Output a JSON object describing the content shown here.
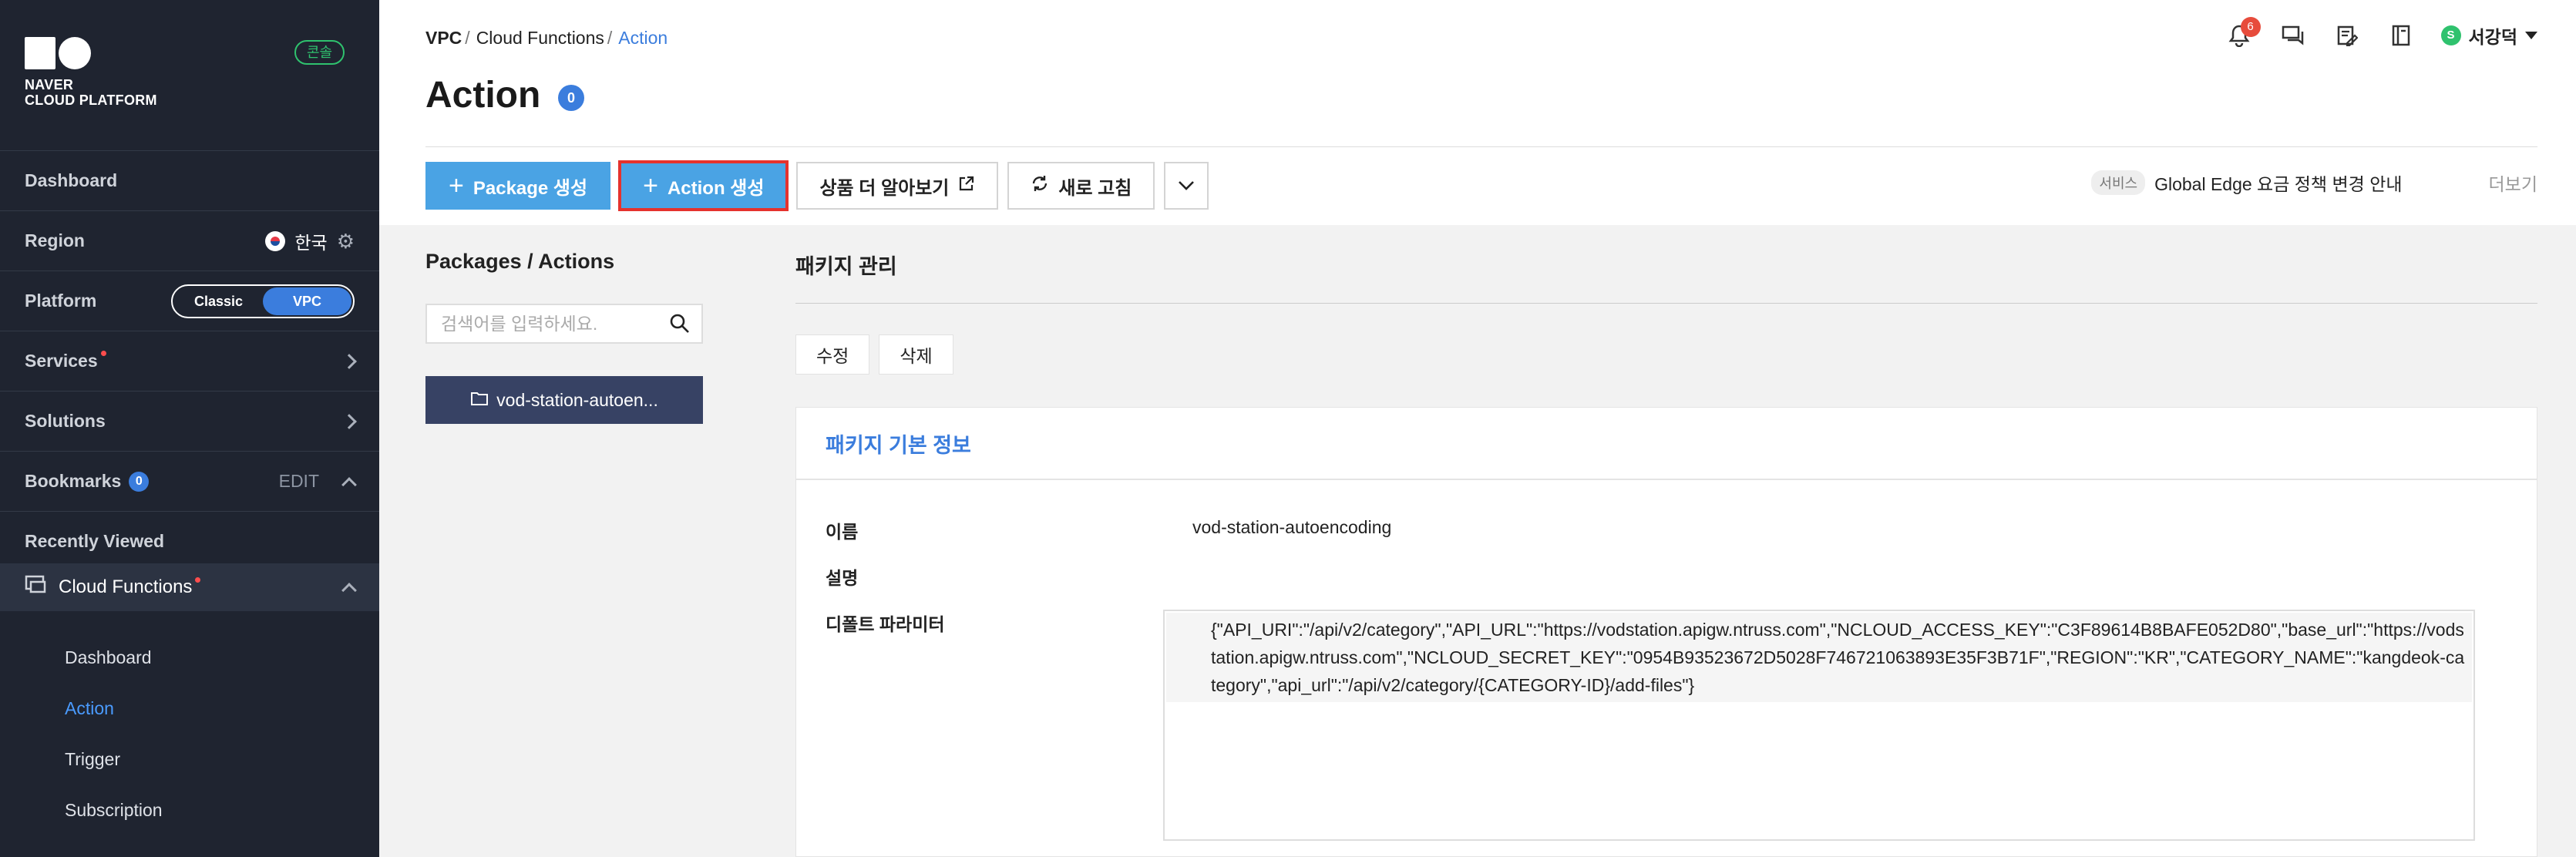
{
  "brand": {
    "line1": "NAVER",
    "line2": "CLOUD PLATFORM",
    "console_badge": "콘솔"
  },
  "sidebar": {
    "dashboard": "Dashboard",
    "region": {
      "label": "Region",
      "value": "한국"
    },
    "platform": {
      "label": "Platform",
      "options": [
        "Classic",
        "VPC"
      ],
      "selected": "VPC"
    },
    "services": "Services",
    "solutions": "Solutions",
    "bookmarks": {
      "label": "Bookmarks",
      "count": "0",
      "edit": "EDIT"
    },
    "recently_viewed": "Recently Viewed",
    "cloud_functions": "Cloud Functions",
    "sub_items": [
      "Dashboard",
      "Action",
      "Trigger",
      "Subscription"
    ],
    "active_sub": "Action"
  },
  "breadcrumb": {
    "root": "VPC",
    "mid": "Cloud Functions",
    "current": "Action",
    "sep": "/"
  },
  "header": {
    "title": "Action",
    "count": "0",
    "notifications": "6",
    "user_initial": "S",
    "user_name": "서강덕"
  },
  "toolbar": {
    "package_create": "Package 생성",
    "action_create": "Action 생성",
    "learn_more": "상품 더 알아보기",
    "refresh": "새로 고침"
  },
  "notice": {
    "tag": "서비스",
    "text": "Global Edge 요금 정책 변경 안내",
    "more": "더보기"
  },
  "left_pane": {
    "title": "Packages / Actions",
    "search_placeholder": "검색어를 입력하세요.",
    "package_item": "vod-station-autoen..."
  },
  "right_pane": {
    "title": "패키지 관리",
    "edit": "수정",
    "delete": "삭제",
    "card_title": "패키지 기본 정보",
    "name_label": "이름",
    "name_value": "vod-station-autoencoding",
    "desc_label": "설명",
    "params_label": "디폴트 파라미터",
    "params_value": "{\"API_URI\":\"/api/v2/category\",\"API_URL\":\"https://vodstation.apigw.ntruss.com\",\"NCLOUD_ACCESS_KEY\":\"C3F89614B8BAFE052D80\",\"base_url\":\"https://vodstation.apigw.ntruss.com\",\"NCLOUD_SECRET_KEY\":\"0954B93523672D5028F746721063893E35F3B71F\",\"REGION\":\"KR\",\"CATEGORY_NAME\":\"kangdeok-category\",\"api_url\":\"/api/v2/category/{CATEGORY-ID}/add-files\"}"
  },
  "colors": {
    "sidebar_bg": "#1f2430",
    "accent": "#3b7ddd",
    "primary_button": "#4aa3e4",
    "highlight": "#e5322d",
    "package_item_bg": "#374264"
  }
}
